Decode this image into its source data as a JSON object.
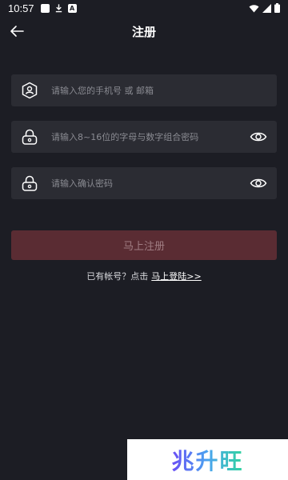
{
  "status_bar": {
    "time": "10:57",
    "left_icons": [
      "square-icon",
      "download-icon",
      "a-icon"
    ],
    "right_icons": [
      "wifi-icon",
      "signal-icon",
      "battery-icon"
    ]
  },
  "header": {
    "title": "注册",
    "back_icon": "arrow-left-icon"
  },
  "form": {
    "account": {
      "placeholder": "请输入您的手机号 或 邮箱",
      "value": "",
      "icon": "user-shield-icon"
    },
    "password": {
      "placeholder": "请输入8~16位的字母与数字组合密码",
      "value": "",
      "icon": "lock-icon",
      "toggle_icon": "eye-icon"
    },
    "confirm": {
      "placeholder": "请输入确认密码",
      "value": "",
      "icon": "lock-icon",
      "toggle_icon": "eye-icon"
    }
  },
  "submit": {
    "label": "马上注册"
  },
  "login_prompt": {
    "text": "已有帐号？点击",
    "link": "马上登陆>>"
  },
  "watermark": {
    "text": "兆升旺"
  },
  "colors": {
    "background": "#1c1d24",
    "field": "#2b2c33",
    "submit_bg": "#5a2c33",
    "submit_text": "#a07d83",
    "placeholder": "#8a8b92"
  }
}
